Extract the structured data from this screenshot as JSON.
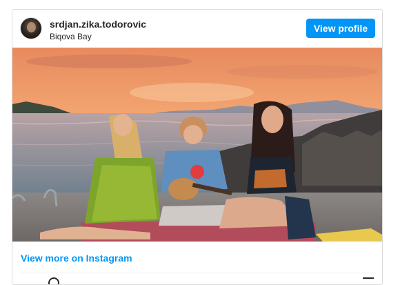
{
  "post": {
    "username": "srdjan.zika.todorovic",
    "location": "Biqova Bay",
    "view_profile_label": "View profile",
    "view_more_label": "View more on Instagram"
  },
  "colors": {
    "accent": "#0095f6",
    "text": "#262626",
    "border": "#dbdbdb"
  },
  "icons": {
    "avatar": "profile-photo",
    "footer_left": "comment-icon",
    "footer_right": "bookmark-icon"
  }
}
